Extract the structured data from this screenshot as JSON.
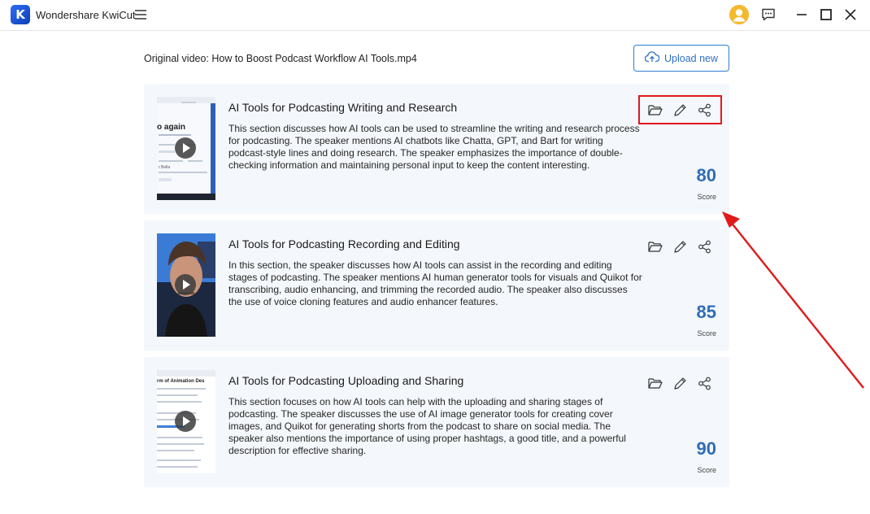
{
  "app": {
    "title": "Wondershare KwiCut",
    "logo_letter": "K"
  },
  "header": {
    "original_video_label": "Original video: How to Boost Podcast Workflow  AI Tools.mp4",
    "upload_button": "Upload new"
  },
  "cards": [
    {
      "title": "AI Tools for Podcasting Writing and Research",
      "description": "This section discusses how AI tools can be used to streamline the writing and research process for podcasting. The speaker mentions AI chatbots like Chatta, GPT, and Bart for writing podcast-style lines and doing research. The speaker emphasizes the importance of double-checking information and maintaining personal input to keep the content interesting.",
      "score": "80",
      "score_label": "Score",
      "thumb_text": [
        "o again",
        "r Bella"
      ]
    },
    {
      "title": "AI Tools for Podcasting Recording and Editing",
      "description": "In this section, the speaker discusses how AI tools can assist in the recording and editing stages of podcasting. The speaker mentions AI human generator tools for visuals and Quikot for transcribing, audio enhancing, and trimming the recorded audio. The speaker also discusses the use of voice cloning features and audio enhancer features.",
      "score": "85",
      "score_label": "Score"
    },
    {
      "title": "AI Tools for Podcasting Uploading and Sharing",
      "description": "This section focuses on how AI tools can help with the uploading and sharing stages of podcasting. The speaker discusses the use of AI image generator tools for creating cover images, and Quikot for generating shorts from the podcast to share on social media. The speaker also mentions the importance of using proper hashtags, a good title, and a powerful description for effective sharing.",
      "score": "90",
      "score_label": "Score",
      "thumb_text": [
        "rm of Animation Des"
      ]
    }
  ],
  "colors": {
    "accent": "#2f6fc6",
    "score": "#2e6db5",
    "highlight": "#e0191b",
    "card_bg": "#f4f7fb"
  },
  "icons": {
    "menu": "hamburger-icon",
    "feedback": "chat-icon",
    "open_folder": "folder-icon",
    "edit": "pencil-icon",
    "share": "share-icon",
    "upload": "cloud-upload-icon"
  }
}
